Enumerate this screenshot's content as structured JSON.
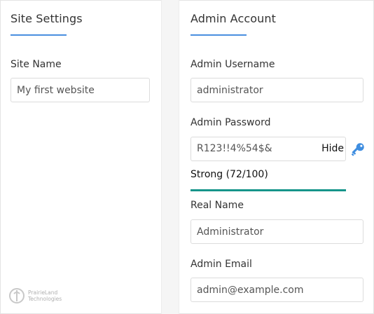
{
  "site_settings": {
    "heading": "Site Settings",
    "site_name_label": "Site Name",
    "site_name_value": "My first website"
  },
  "admin_account": {
    "heading": "Admin Account",
    "username_label": "Admin Username",
    "username_value": "administrator",
    "password_label": "Admin Password",
    "password_value": "R123!!4%54$&",
    "password_toggle_label": "Hide",
    "strength_text": "Strong (72/100)",
    "strength_score": 72,
    "strength_max": 100,
    "real_name_label": "Real Name",
    "real_name_value": "Administrator",
    "email_label": "Admin Email",
    "email_value": "admin@example.com"
  },
  "branding": {
    "logo_line1": "PrairieLand",
    "logo_line2": "Technologies"
  },
  "icons": {
    "key": "key-icon",
    "logo": "logo-icon"
  },
  "colors": {
    "accent": "#4a8fe0",
    "strength": "#16958a",
    "key_icon": "#3f8ee0"
  }
}
